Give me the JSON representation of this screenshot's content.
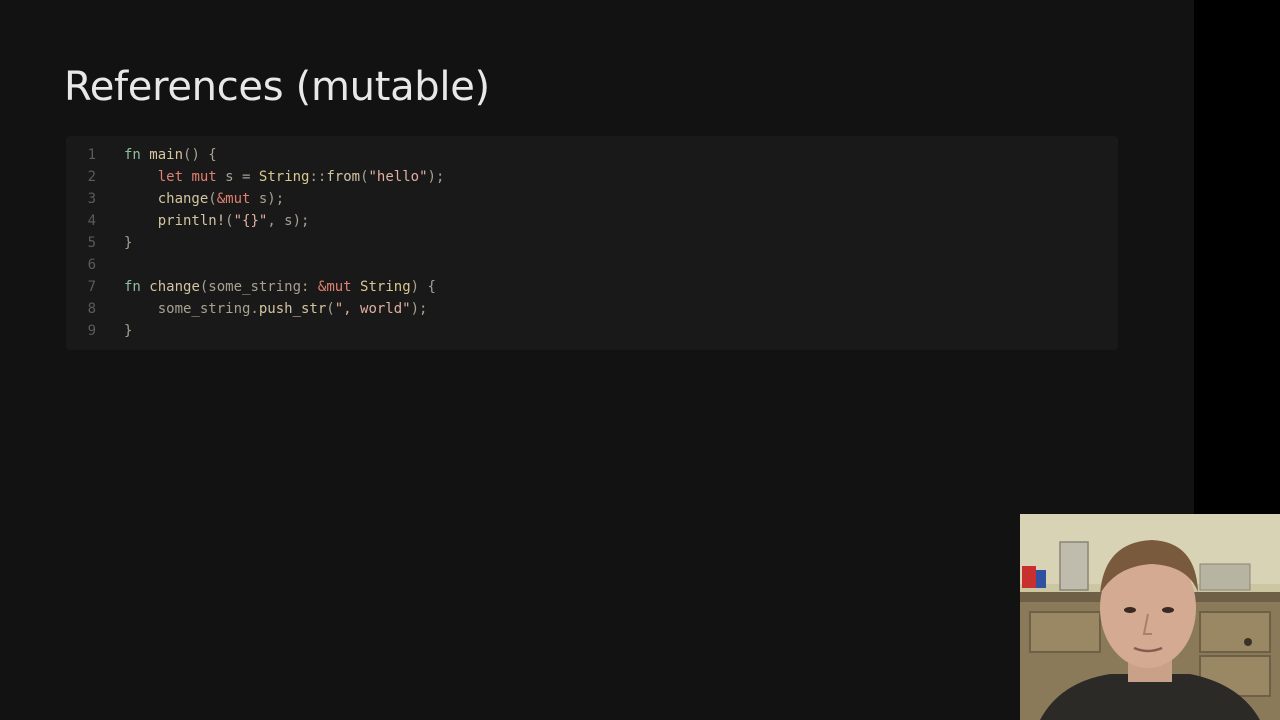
{
  "slide": {
    "title": "References (mutable)"
  },
  "code": {
    "line_numbers": [
      "1",
      "2",
      "3",
      "4",
      "5",
      "6",
      "7",
      "8",
      "9"
    ],
    "lines": [
      [
        [
          "kw",
          "fn"
        ],
        [
          "pun",
          " "
        ],
        [
          "fnname",
          "main"
        ],
        [
          "pun",
          "() {"
        ]
      ],
      [
        [
          "pun",
          "    "
        ],
        [
          "kw2",
          "let"
        ],
        [
          "pun",
          " "
        ],
        [
          "kw2",
          "mut"
        ],
        [
          "pun",
          " s = "
        ],
        [
          "ty",
          "String"
        ],
        [
          "pun",
          "::"
        ],
        [
          "fnname",
          "from"
        ],
        [
          "pun",
          "("
        ],
        [
          "str",
          "\"hello\""
        ],
        [
          "pun",
          ");"
        ]
      ],
      [
        [
          "pun",
          "    "
        ],
        [
          "fnname",
          "change"
        ],
        [
          "pun",
          "("
        ],
        [
          "kw2",
          "&mut"
        ],
        [
          "pun",
          " s);"
        ]
      ],
      [
        [
          "pun",
          "    "
        ],
        [
          "macro",
          "println!"
        ],
        [
          "pun",
          "("
        ],
        [
          "str",
          "\"{}\""
        ],
        [
          "pun",
          ", s);"
        ]
      ],
      [
        [
          "pun",
          "}"
        ]
      ],
      [],
      [
        [
          "kw",
          "fn"
        ],
        [
          "pun",
          " "
        ],
        [
          "fnname",
          "change"
        ],
        [
          "pun",
          "(some_string: "
        ],
        [
          "kw2",
          "&mut"
        ],
        [
          "pun",
          " "
        ],
        [
          "ty",
          "String"
        ],
        [
          "pun",
          ") {"
        ]
      ],
      [
        [
          "pun",
          "    some_string."
        ],
        [
          "fnname",
          "push_str"
        ],
        [
          "pun",
          "("
        ],
        [
          "str",
          "\", world\""
        ],
        [
          "pun",
          ");"
        ]
      ],
      [
        [
          "pun",
          "}"
        ]
      ]
    ]
  },
  "colors": {
    "slide_background": "#121212",
    "code_background": "#191919",
    "title_text": "#e8e8e8"
  },
  "webcam": {
    "description_icon": "presenter-video-feed"
  }
}
